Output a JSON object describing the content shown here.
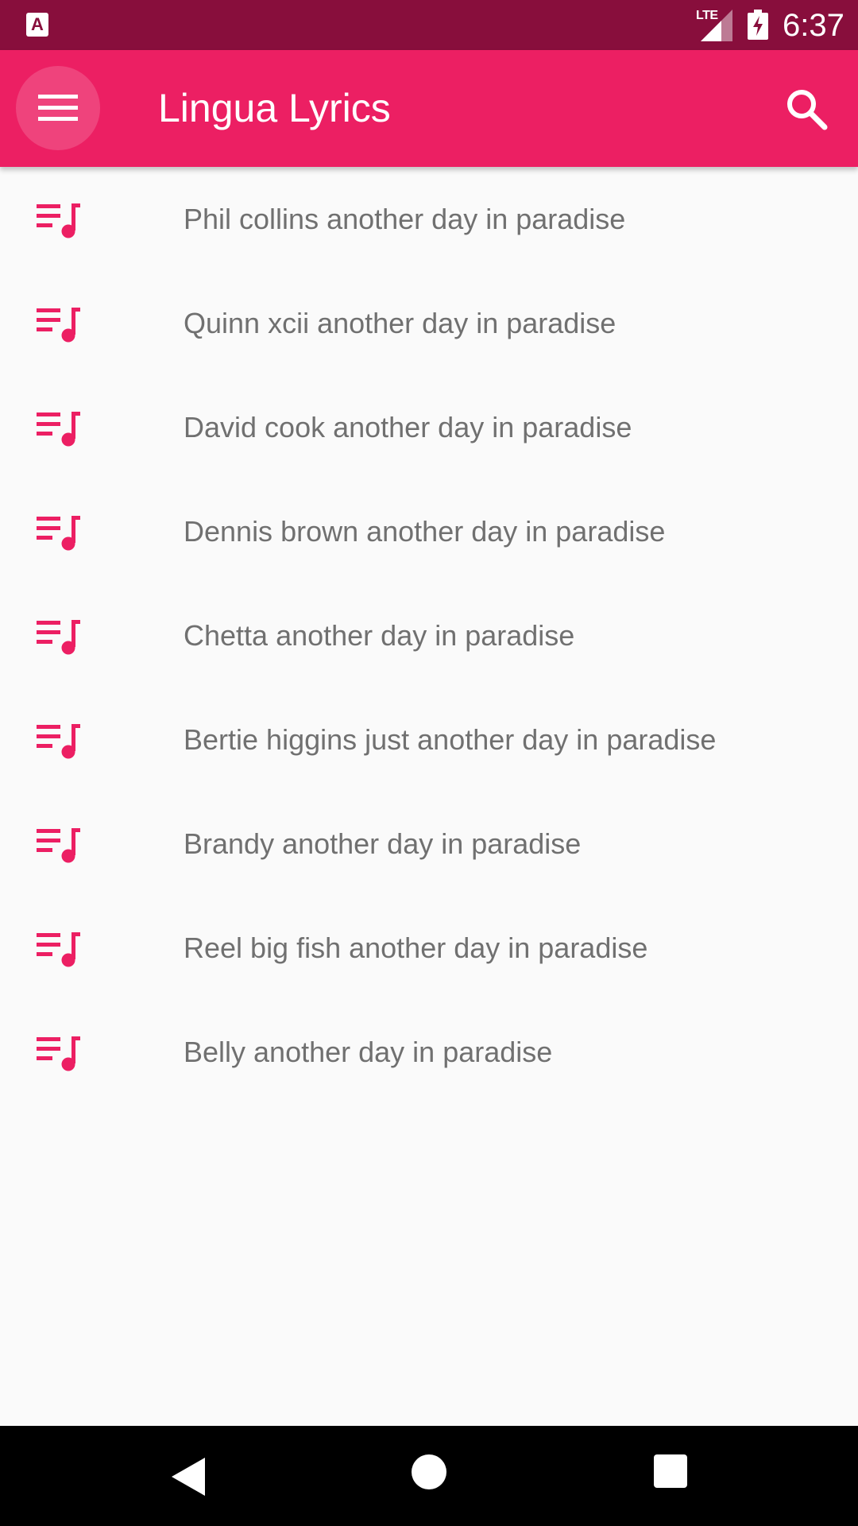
{
  "status_bar": {
    "notification_icon": "app-notification-icon",
    "notification_glyph": "A",
    "network_label": "LTE",
    "signal_icon": "cell-signal-icon",
    "battery_icon": "battery-charging-icon",
    "time": "6:37"
  },
  "app_bar": {
    "menu_icon": "hamburger-menu-icon",
    "title": "Lingua Lyrics",
    "search_icon": "search-icon"
  },
  "song_list": {
    "item_icon": "playlist-music-icon",
    "items": [
      {
        "label": "Phil collins another day in paradise"
      },
      {
        "label": "Quinn xcii another day in paradise"
      },
      {
        "label": "David cook another day in paradise"
      },
      {
        "label": "Dennis brown another day in paradise"
      },
      {
        "label": "Chetta another day in paradise"
      },
      {
        "label": "Bertie higgins just another day in paradise"
      },
      {
        "label": "Brandy another day in paradise"
      },
      {
        "label": "Reel big fish another day in paradise"
      },
      {
        "label": "Belly another day in paradise"
      }
    ]
  },
  "nav_bar": {
    "back_icon": "back-triangle-icon",
    "home_icon": "home-circle-icon",
    "recents_icon": "recents-square-icon"
  },
  "colors": {
    "status_bar": "#880e3c",
    "app_bar": "#ec1f63",
    "accent": "#ec1f63",
    "list_text": "#707070",
    "background": "#fafafa",
    "nav_bar": "#000000"
  }
}
